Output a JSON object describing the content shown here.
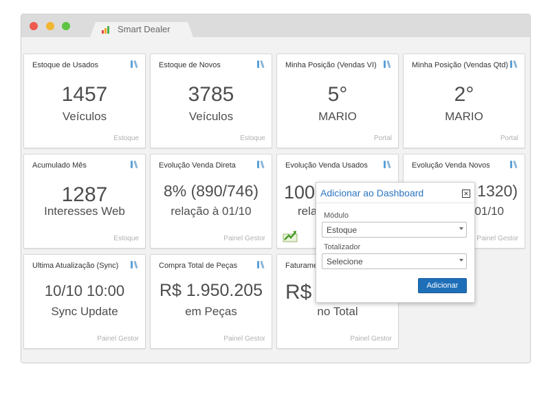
{
  "tab": {
    "title": "Smart Dealer"
  },
  "cards": [
    {
      "title": "Estoque de Usados",
      "value": "1457",
      "label": "Veículos",
      "source": "Estoque"
    },
    {
      "title": "Estoque de Novos",
      "value": "3785",
      "label": "Veículos",
      "source": "Estoque"
    },
    {
      "title": "Minha Posição (Vendas VI)",
      "value": "5°",
      "label": "MARIO",
      "source": "Portal"
    },
    {
      "title": "Minha Posição (Vendas Qtd)",
      "value": "2°",
      "label": "MARIO",
      "source": "Portal"
    },
    {
      "title": "Acumulado Mês",
      "value": "1287",
      "label": "Interesses Web",
      "source": "Estoque"
    },
    {
      "title": "Evolução Venda Direta",
      "value": "8% (890/746)",
      "label": "relação à 01/10",
      "source": "Painel Gestor"
    },
    {
      "title": "Evolução Venda Usados",
      "value": "100",
      "label": "rela",
      "source": ""
    },
    {
      "title": "Evolução Venda Novos",
      "value": "1320)",
      "label": "01/10",
      "source": "Painel Gestor"
    },
    {
      "title": "Ultima Atualização (Sync)",
      "value": "10/10 10:00",
      "label": "Sync Update",
      "source": "Painel Gestor"
    },
    {
      "title": "Compra Total de Peças",
      "value": "R$ 1.950.205",
      "label": "em Peças",
      "source": "Painel Gestor"
    },
    {
      "title": "Faturamen",
      "value": "R$",
      "label": "no Total",
      "source": "Painel Gestor"
    }
  ],
  "modal": {
    "title": "Adicionar ao Dashboard",
    "modulo_label": "Módulo",
    "modulo_value": "Estoque",
    "totalizador_label": "Totalizador",
    "totalizador_value": "Selecione",
    "add_button": "Adicionar"
  },
  "colors": {
    "accent": "#2b74c0",
    "button": "#1f6fb8",
    "text": "#4d4d4d",
    "source_text": "#b0b0b0"
  }
}
